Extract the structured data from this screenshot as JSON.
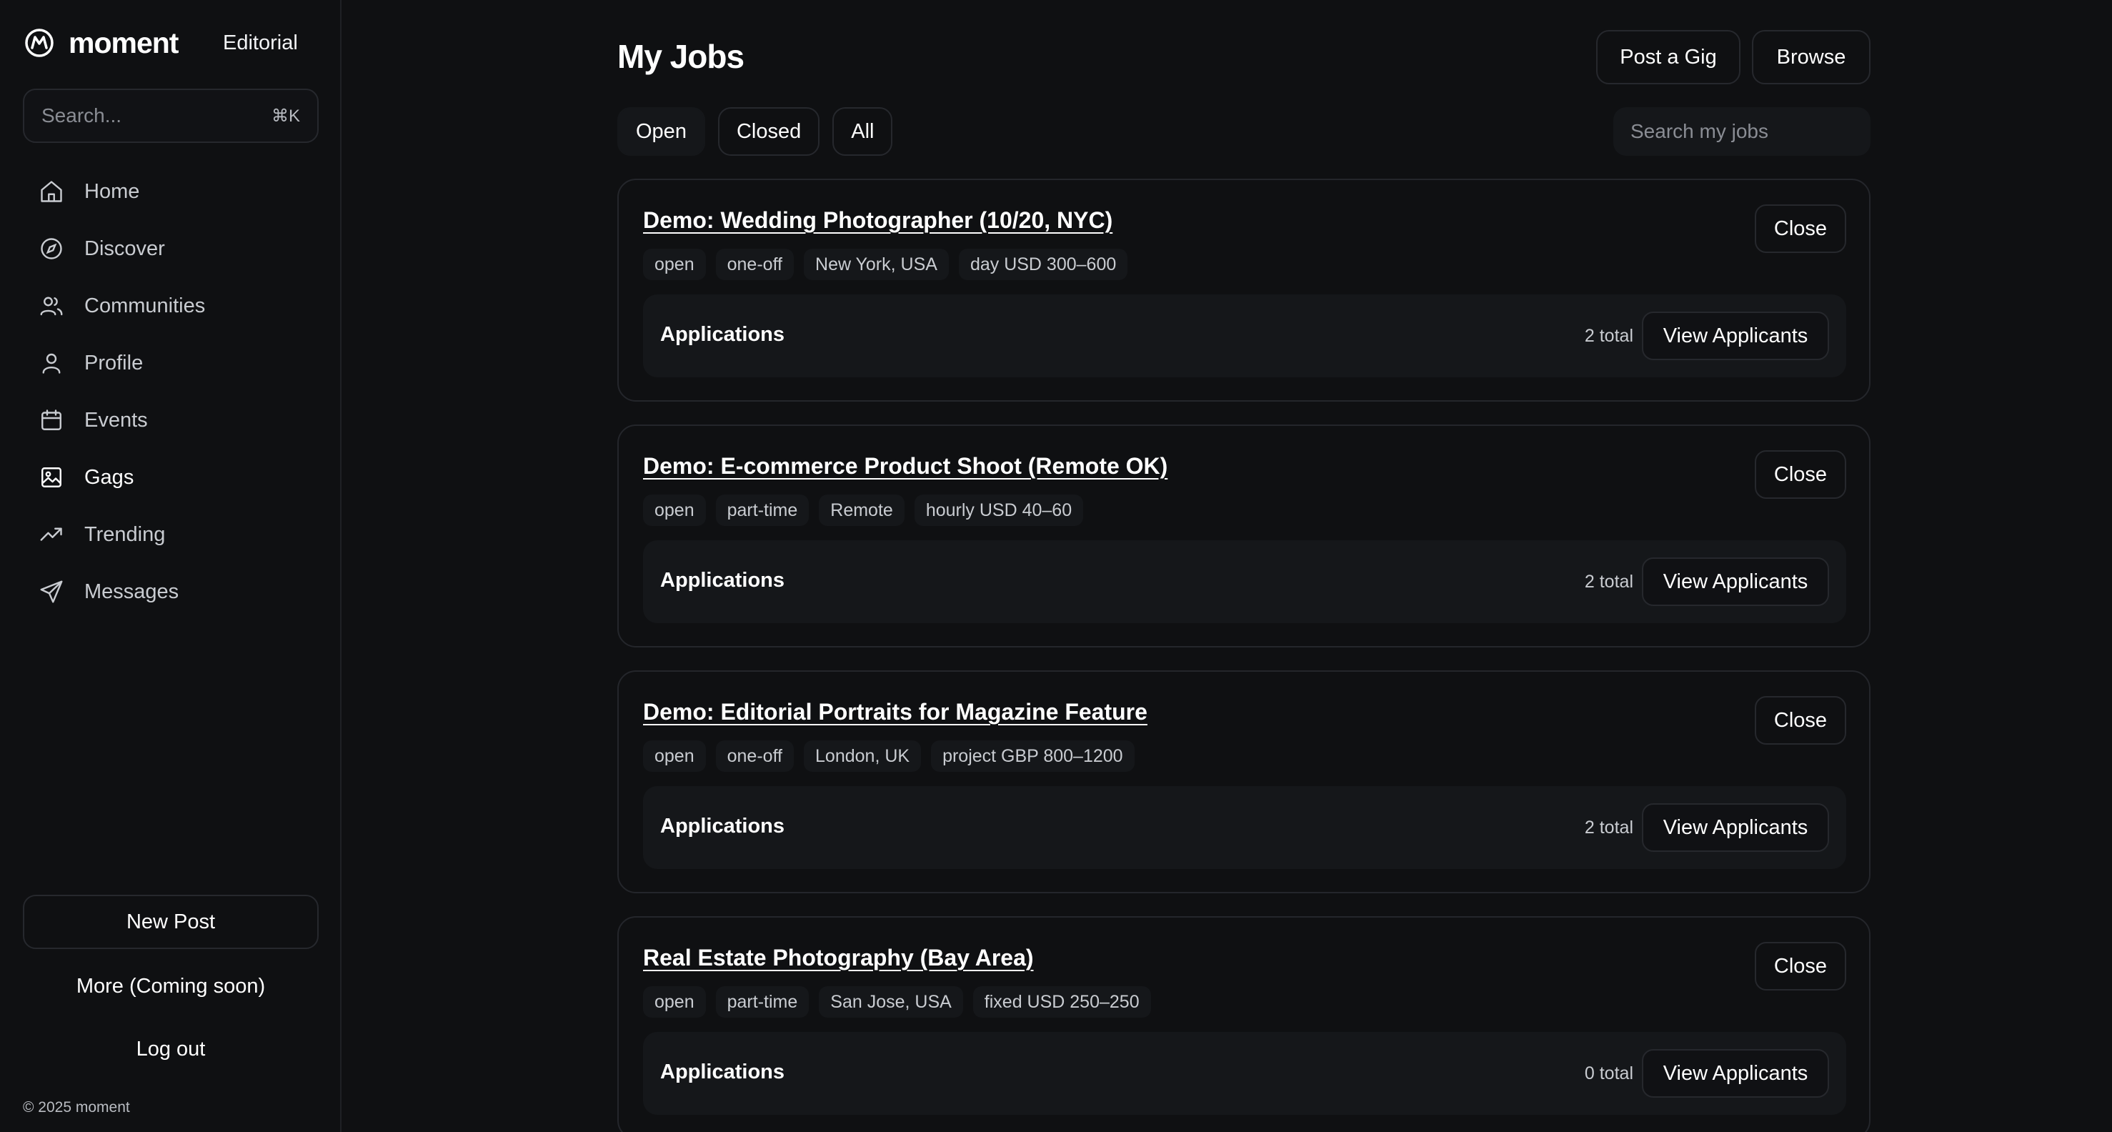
{
  "brand": {
    "name": "moment",
    "mode": "Editorial"
  },
  "sidebar": {
    "search_placeholder": "Search...",
    "shortcut": "⌘K",
    "items": [
      {
        "label": "Home",
        "icon": "home-icon"
      },
      {
        "label": "Discover",
        "icon": "compass-icon"
      },
      {
        "label": "Communities",
        "icon": "users-icon"
      },
      {
        "label": "Profile",
        "icon": "user-icon"
      },
      {
        "label": "Events",
        "icon": "calendar-icon"
      },
      {
        "label": "Gags",
        "icon": "image-icon",
        "active": true
      },
      {
        "label": "Trending",
        "icon": "trending-icon"
      },
      {
        "label": "Messages",
        "icon": "send-icon"
      }
    ],
    "new_post": "New Post",
    "more": "More (Coming soon)",
    "logout": "Log out",
    "copyright": "© 2025 moment"
  },
  "header": {
    "title": "My Jobs",
    "post_gig": "Post a Gig",
    "browse": "Browse"
  },
  "filters": {
    "open": "Open",
    "closed": "Closed",
    "all": "All",
    "active": "Open"
  },
  "job_search": {
    "placeholder": "Search my jobs"
  },
  "jobs": [
    {
      "title": "Demo: Wedding Photographer (10/20, NYC)",
      "tags": [
        "open",
        "one-off",
        "New York, USA",
        "day USD 300–600"
      ],
      "close": "Close",
      "applications_label": "Applications",
      "applications_count": "2 total",
      "view": "View Applicants"
    },
    {
      "title": "Demo: E-commerce Product Shoot (Remote OK)",
      "tags": [
        "open",
        "part-time",
        "Remote",
        "hourly USD 40–60"
      ],
      "close": "Close",
      "applications_label": "Applications",
      "applications_count": "2 total",
      "view": "View Applicants"
    },
    {
      "title": "Demo: Editorial Portraits for Magazine Feature",
      "tags": [
        "open",
        "one-off",
        "London, UK",
        "project GBP 800–1200"
      ],
      "close": "Close",
      "applications_label": "Applications",
      "applications_count": "2 total",
      "view": "View Applicants"
    },
    {
      "title": "Real Estate Photography (Bay Area)",
      "tags": [
        "open",
        "part-time",
        "San Jose, USA",
        "fixed USD 250–250"
      ],
      "close": "Close",
      "applications_label": "Applications",
      "applications_count": "0 total",
      "view": "View Applicants"
    }
  ]
}
